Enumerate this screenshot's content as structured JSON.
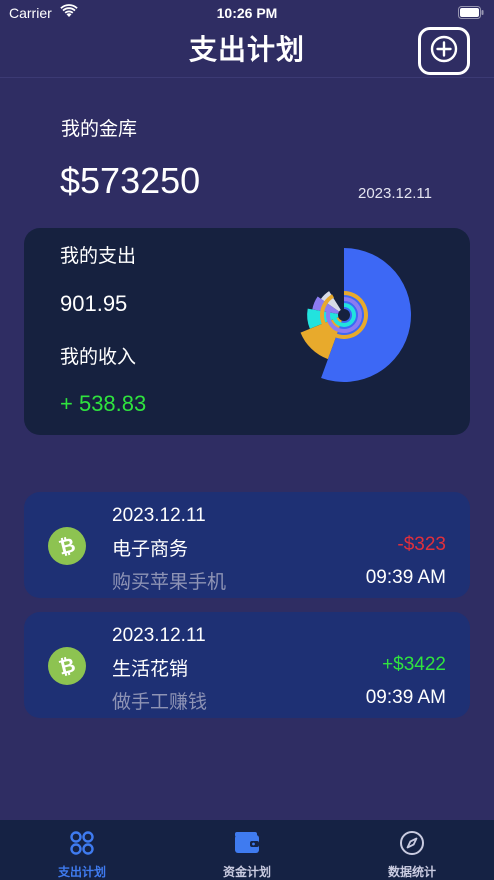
{
  "status_bar": {
    "carrier": "Carrier",
    "time": "10:26 PM"
  },
  "header": {
    "title": "支出计划",
    "add_icon": "plus-circle-icon"
  },
  "vault": {
    "label": "我的金库",
    "amount": "$573250",
    "date": "2023.12.11"
  },
  "summary": {
    "expense_label": "我的支出",
    "expense_value": "901.95",
    "income_label": "我的收入",
    "income_value": "+ 538.83"
  },
  "chart_data": {
    "type": "pie",
    "variant": "polar-area",
    "slices": [
      {
        "color": "#3d68f5",
        "value": 100
      },
      {
        "color": "#e8aa2c",
        "value": 70
      },
      {
        "color": "#22e3de",
        "value": 55
      },
      {
        "color": "#8b7cf2",
        "value": 48
      },
      {
        "color": "#d7dbe7",
        "value": 42
      }
    ]
  },
  "transactions": [
    {
      "date": "2023.12.11",
      "category": "电子商务",
      "description": "购买苹果手机",
      "amount": "-$323",
      "time": "09:39 AM",
      "icon": "bitcoin-icon"
    },
    {
      "date": "2023.12.11",
      "category": "生活花销",
      "description": "做手工赚钱",
      "amount": "+$3422",
      "time": "09:39 AM",
      "icon": "bitcoin-icon"
    }
  ],
  "tabs": [
    {
      "label": "支出计划",
      "icon": "grid-icon",
      "active": true
    },
    {
      "label": "资金计划",
      "icon": "wallet-icon",
      "active": false
    },
    {
      "label": "数据统计",
      "icon": "compass-icon",
      "active": false
    }
  ],
  "colors": {
    "background": "#2f2d63",
    "card": "#16213f",
    "tx_card": "#1e3074",
    "negative": "#e02f3c",
    "positive": "#2fe33e",
    "tab_active": "#3f7bf0"
  }
}
